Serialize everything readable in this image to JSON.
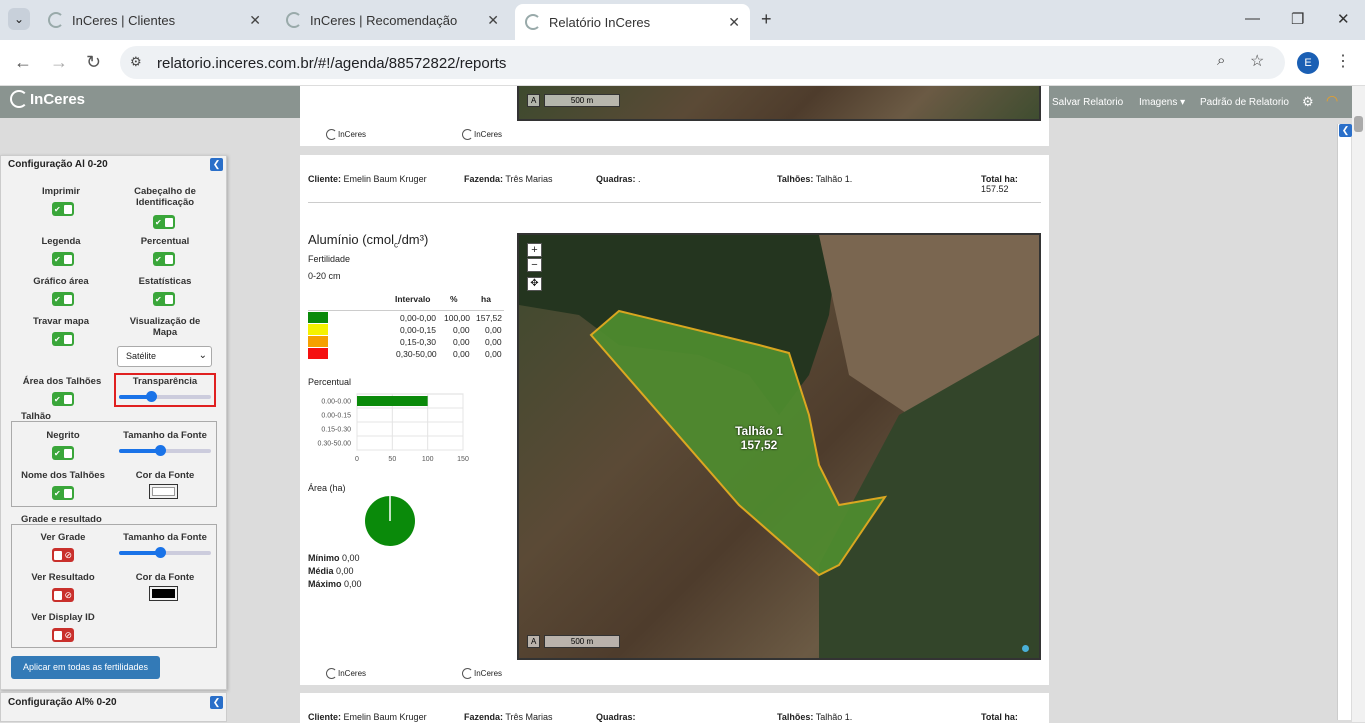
{
  "browser": {
    "tabs": [
      {
        "label": "InCeres | Clientes"
      },
      {
        "label": "InCeres | Recomendação"
      },
      {
        "label": "Relatório InCeres"
      }
    ],
    "url": "relatorio.inceres.com.br/#!/agenda/88572822/reports",
    "profile_initial": "E"
  },
  "header": {
    "logo": "InCeres",
    "links": [
      "Salvar Relatorio",
      "Imagens",
      "Padrão de Relatorio"
    ]
  },
  "config_panel": {
    "title": "Configuração Al 0-20",
    "imprimir": "Imprimir",
    "cabecalho": "Cabeçalho de Identificação",
    "legenda": "Legenda",
    "percentual": "Percentual",
    "grafico_area": "Gráfico área",
    "estatisticas": "Estatísticas",
    "travar_mapa": "Travar mapa",
    "visualizacao_mapa": "Visualização de Mapa",
    "map_select_value": "Satélite",
    "area_talhoes": "Área dos Talhões",
    "transparencia": "Transparência",
    "transparencia_value": 0.35,
    "talhao_group": "Talhão",
    "negrito": "Negrito",
    "tamanho_fonte": "Tamanho da Fonte",
    "tamanho_fonte_value": 0.45,
    "nome_talhoes": "Nome dos Talhões",
    "cor_fonte": "Cor da Fonte",
    "grade_group": "Grade e resultado",
    "ver_grade": "Ver Grade",
    "tamanho_fonte2": "Tamanho da Fonte",
    "tamanho_fonte2_value": 0.45,
    "ver_resultado": "Ver Resultado",
    "cor_fonte2": "Cor da Fonte",
    "ver_display_id": "Ver Display ID",
    "apply_button": "Aplicar em todas as fertilidades",
    "next_title": "Configuração Al% 0-20"
  },
  "report": {
    "cliente_label": "Cliente:",
    "cliente": "Emelin Baum Kruger",
    "fazenda_label": "Fazenda:",
    "fazenda": "Três Marias",
    "quadras_label": "Quadras:",
    "quadras": ".",
    "talhoes_label": "Talhões:",
    "talhoes": "Talhão 1.",
    "total_label": "Total ha:",
    "total": "157.52",
    "title_main": "Alumínio (cmol",
    "title_sub": "c",
    "title_end": "/dm³)",
    "fertilidade": "Fertilidade",
    "profundidade": "0-20 cm",
    "table_headers": [
      "Intervalo",
      "%",
      "ha"
    ],
    "table_rows": [
      {
        "color": "#0a8a0a",
        "intervalo": "0,00-0,00",
        "pct": "100,00",
        "ha": "157,52"
      },
      {
        "color": "#f5f200",
        "intervalo": "0,00-0,15",
        "pct": "0,00",
        "ha": "0,00"
      },
      {
        "color": "#f5a000",
        "intervalo": "0,15-0,30",
        "pct": "0,00",
        "ha": "0,00"
      },
      {
        "color": "#f51010",
        "intervalo": "0,30-50,00",
        "pct": "0,00",
        "ha": "0,00"
      }
    ],
    "percentual": "Percentual",
    "area_ha": "Área (ha)",
    "minimo_label": "Mínimo",
    "minimo": "0,00",
    "media_label": "Média",
    "media": "0,00",
    "maximo_label": "Máximo",
    "maximo": "0,00",
    "map_label_name": "Talhão 1",
    "map_label_value": "157,52",
    "scale": "500 m",
    "footer_logo": "InCeres"
  },
  "chart_data": {
    "type": "bar",
    "orientation": "horizontal",
    "categories": [
      "0.00-0.00",
      "0.00-0.15",
      "0.15-0.30",
      "0.30-50.00"
    ],
    "values": [
      100,
      0,
      0,
      0
    ],
    "xlim": [
      0,
      150
    ],
    "xticks": [
      "0",
      "50",
      "100",
      "150"
    ],
    "color": "#0a8a0a"
  }
}
